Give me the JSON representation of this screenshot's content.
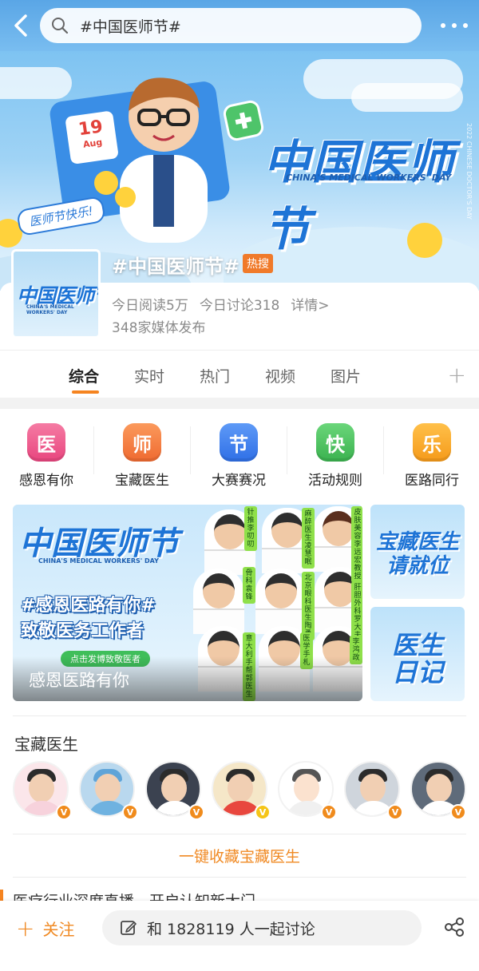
{
  "search": {
    "query": "#中国医师节#"
  },
  "banner": {
    "title": "中国医师节",
    "subtitle": "CHINA'S MEDICAL WORKERS' DAY",
    "happy_tag": "医师节快乐!",
    "calendar_day": "19",
    "calendar_month": "Aug",
    "side_text": "2022 CHINESE DOCTOR'S DAY"
  },
  "topic": {
    "name": "#中国医师节#",
    "hot_badge": "热搜",
    "thumb_title": "中国医师节",
    "thumb_sub": "CHINA'S MEDICAL WORKERS' DAY",
    "reads_today": "今日阅读5万",
    "discussions_today": "今日讨论318",
    "details": "详情>",
    "media_count": "348家媒体发布"
  },
  "tabs": [
    "综合",
    "实时",
    "热门",
    "视频",
    "图片"
  ],
  "active_tab": 0,
  "tab_add": "+",
  "quick_items": [
    {
      "glyph": "医",
      "label": "感恩有你",
      "color": "#ef5a8f"
    },
    {
      "glyph": "师",
      "label": "宝藏医生",
      "color": "#f57a3c"
    },
    {
      "glyph": "节",
      "label": "大赛赛况",
      "color": "#3b7ef0"
    },
    {
      "glyph": "快",
      "label": "活动规则",
      "color": "#47c15a"
    },
    {
      "glyph": "乐",
      "label": "医路同行",
      "color": "#f5a623"
    }
  ],
  "promo_main": {
    "title": "中国医师节",
    "subtitle": "CHINA'S MEDICAL WORKERS' DAY",
    "headline1": "#感恩医路有你#",
    "headline2": "致敬医务工作者",
    "pill": "点击发博致敬医者",
    "caption": "感恩医路有你",
    "doctor_tags": [
      "针推李叨叨",
      "麻醉医生凌慧眠",
      "皮肤美容李远宏教授",
      "骨科袁锋",
      "北京眼科医生陶勇",
      "肝胆外科罗大夫",
      "意大利手帮郭医生",
      "医学手札",
      "李鸿政"
    ]
  },
  "promo_side": [
    {
      "line1": "宝藏医生",
      "line2": "请就位"
    },
    {
      "line1": "医生",
      "line2": "日记"
    }
  ],
  "treasure": {
    "title": "宝藏医生",
    "badges": [
      "V",
      "V",
      "V",
      "V",
      "V",
      "V",
      "V"
    ],
    "collect_link": "一键收藏宝藏医生"
  },
  "next_section": {
    "title": "医疗行业深度直播，开启认知新大门"
  },
  "bottom": {
    "follow": "关注",
    "discuss": "和 1828119 人一起讨论"
  },
  "colors": {
    "accent": "#f58420",
    "brand_blue": "#1e74d6",
    "hot_badge": "#f07a2a"
  }
}
